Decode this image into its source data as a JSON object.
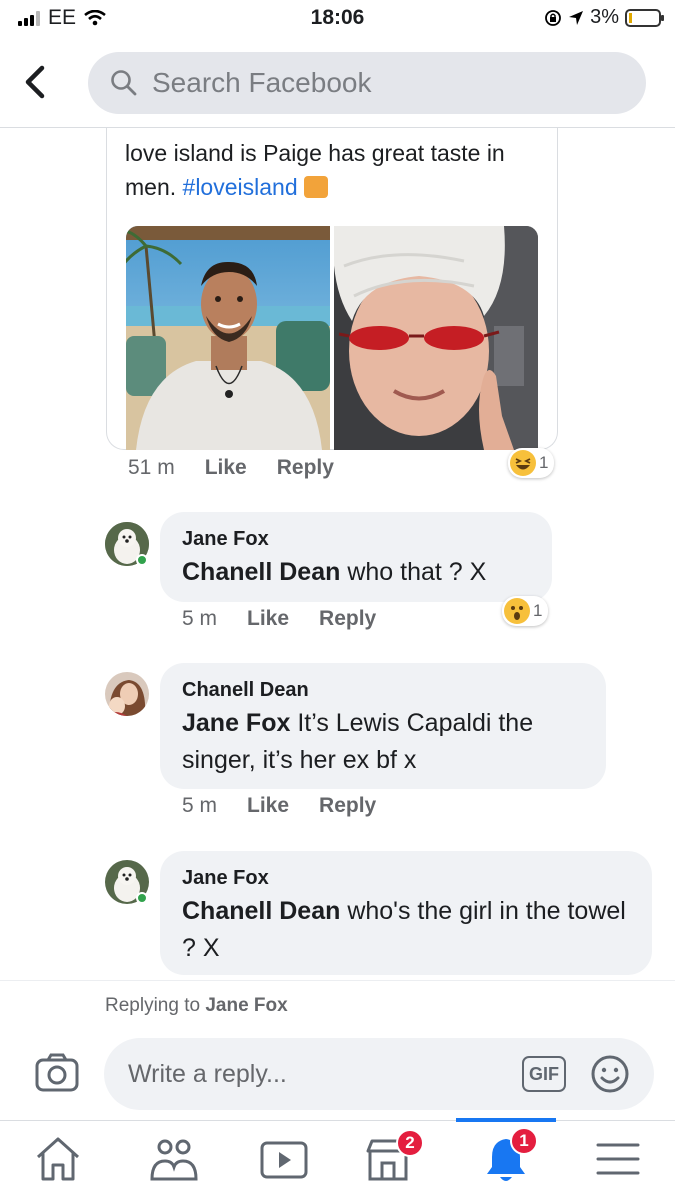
{
  "status_bar": {
    "carrier": "EE",
    "time": "18:06",
    "battery_percent": "3%"
  },
  "header": {
    "search_placeholder": "Search Facebook"
  },
  "post": {
    "text": "love island is Paige has great taste in men.",
    "hashtag": "#loveisland",
    "time": "51 m",
    "like_label": "Like",
    "reply_label": "Reply",
    "reaction_count": "1",
    "reaction": "laughing"
  },
  "comments": [
    {
      "author": "Jane Fox",
      "mention": "Chanell Dean",
      "text": " who that ? X",
      "time": "5 m",
      "like_label": "Like",
      "reply_label": "Reply",
      "reaction_count": "1",
      "reaction": "wow"
    },
    {
      "author": "Chanell Dean",
      "mention": "Jane Fox",
      "text": " It’s Lewis Capaldi the singer, it’s her ex bf x",
      "time": "5 m",
      "like_label": "Like",
      "reply_label": "Reply"
    },
    {
      "author": "Jane Fox",
      "mention": "Chanell Dean",
      "text": " who's  the girl in the towel ? X"
    }
  ],
  "composer": {
    "replying_prefix": "Replying to ",
    "replying_to": "Jane Fox",
    "placeholder": "Write a reply...",
    "gif_label": "GIF"
  },
  "bottom_nav": {
    "marketplace_badge": "2",
    "notifications_badge": "1",
    "active_tab": "notifications"
  },
  "colors": {
    "accent": "#1877f2",
    "hashtag": "#216fdb",
    "badge": "#e41e3f",
    "bubble": "#f0f2f5"
  }
}
